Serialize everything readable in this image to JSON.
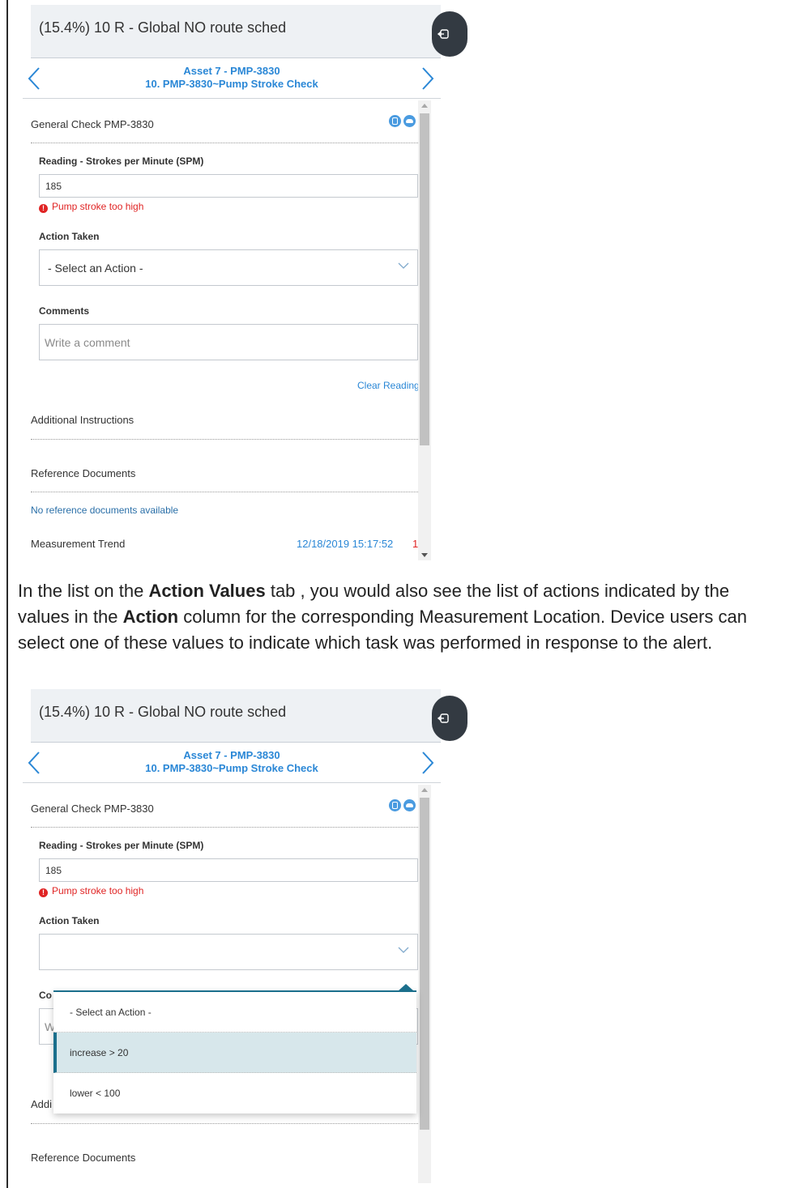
{
  "colors": {
    "accent_blue": "#2a87d6",
    "error_red": "#e02424",
    "teal_selection": "#1b6f8c",
    "header_bg": "#eef1f4"
  },
  "shot1": {
    "header_title": "(15.4%) 10 R - Global NO route sched",
    "asset_title": "Asset 7 - PMP-3830",
    "check_title": "10. PMP-3830~Pump Stroke Check",
    "section_title": "General Check PMP-3830",
    "reading_label": "Reading - Strokes per Minute (SPM)",
    "reading_value": "185",
    "reading_error": "Pump stroke too high",
    "action_label": "Action Taken",
    "action_selected": "- Select an Action -",
    "comments_label": "Comments",
    "comments_placeholder": "Write a comment",
    "clear_reading": "Clear Reading",
    "additional_instructions": "Additional Instructions",
    "reference_documents": "Reference Documents",
    "no_reference_docs": "No reference documents available",
    "measurement_trend": "Measurement Trend",
    "trend_date": "12/18/2019 15:17:52",
    "trend_value": "1"
  },
  "paragraph": {
    "p1": "In the list on the ",
    "b1": "Action Values",
    "p2": " tab , you would also see the list of actions indicated by the values in the ",
    "b2": "Action",
    "p3": " column for the corresponding Measurement Location. Device users can select one of these values to indicate which task was performed in response to the alert."
  },
  "shot2": {
    "header_title": "(15.4%) 10 R - Global NO route sched",
    "asset_title": "Asset 7 - PMP-3830",
    "check_title": "10. PMP-3830~Pump Stroke Check",
    "section_title": "General Check PMP-3830",
    "reading_label": "Reading - Strokes per Minute (SPM)",
    "reading_value": "185",
    "reading_error": "Pump stroke too high",
    "action_label": "Action Taken",
    "comments_label_partial": "Co",
    "comment_placeholder_partial": "W",
    "additional_instructions_partial": "Addi",
    "reference_documents": "Reference Documents",
    "dropdown_options": [
      "- Select an Action -",
      "increase > 20",
      "lower < 100"
    ],
    "selected_option": "increase > 20"
  }
}
